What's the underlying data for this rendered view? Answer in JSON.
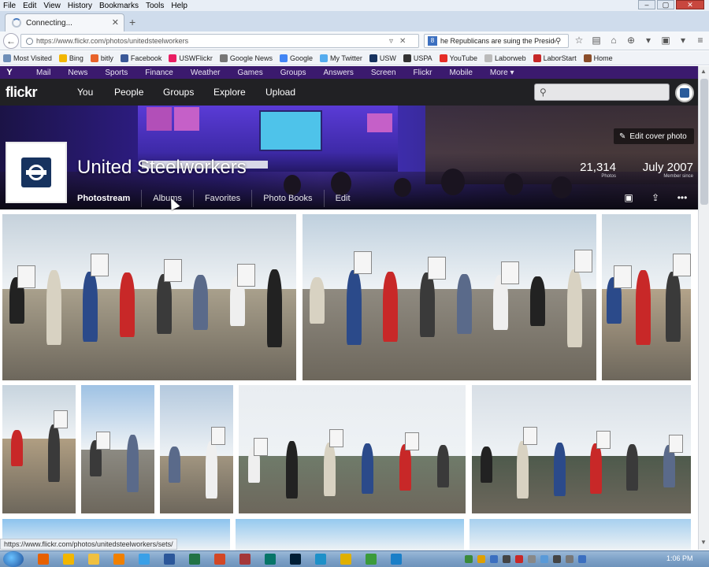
{
  "browser": {
    "menu": [
      "File",
      "Edit",
      "View",
      "History",
      "Bookmarks",
      "Tools",
      "Help"
    ],
    "tab_title": "Connecting...",
    "url": "https://www.flickr.com/photos/unitedsteelworkers",
    "search_value": "he Republicans are suing the President",
    "bookmarks": [
      {
        "label": "Most Visited",
        "color": "#6f8fb8"
      },
      {
        "label": "Bing",
        "color": "#f2b600"
      },
      {
        "label": "bitly",
        "color": "#e8632b"
      },
      {
        "label": "Facebook",
        "color": "#3b5998"
      },
      {
        "label": "USWFlickr",
        "color": "#e91e63"
      },
      {
        "label": "Google News",
        "color": "#777777"
      },
      {
        "label": "Google",
        "color": "#4285f4"
      },
      {
        "label": "My Twitter",
        "color": "#55acee"
      },
      {
        "label": "USW",
        "color": "#17335f"
      },
      {
        "label": "USPA",
        "color": "#333333"
      },
      {
        "label": "YouTube",
        "color": "#e52d27"
      },
      {
        "label": "Laborweb",
        "color": "#bbbbbb"
      },
      {
        "label": "LaborStart",
        "color": "#c62828"
      },
      {
        "label": "Home",
        "color": "#8a4d2a"
      }
    ],
    "status_url": "https://www.flickr.com/photos/unitedsteelworkers/sets/"
  },
  "yahoo": {
    "logo": "Y",
    "items": [
      "Mail",
      "News",
      "Sports",
      "Finance",
      "Weather",
      "Games",
      "Groups",
      "Answers",
      "Screen",
      "Flickr",
      "Mobile"
    ],
    "more": "More ▾"
  },
  "flickr": {
    "logo": "flickr",
    "nav": [
      "You",
      "People",
      "Groups",
      "Explore",
      "Upload"
    ],
    "search_placeholder": ""
  },
  "profile": {
    "name": "United Steelworkers",
    "photos_count": "21,314",
    "photos_label": "Photos",
    "member_since": "July 2007",
    "member_since_label": "Member since",
    "edit_cover": "Edit cover photo",
    "tabs": [
      "Photostream",
      "Albums",
      "Favorites",
      "Photo Books",
      "Edit"
    ],
    "active_tab": "Photostream"
  },
  "taskbar": {
    "clock": "1:06 PM",
    "apps": [
      {
        "name": "firefox",
        "color": "#e66000"
      },
      {
        "name": "outlook",
        "color": "#f2b600"
      },
      {
        "name": "explorer",
        "color": "#f0c040"
      },
      {
        "name": "media",
        "color": "#f08000"
      },
      {
        "name": "ie",
        "color": "#3aa0e8"
      },
      {
        "name": "word",
        "color": "#2b579a"
      },
      {
        "name": "excel",
        "color": "#217346"
      },
      {
        "name": "powerpoint",
        "color": "#d24726"
      },
      {
        "name": "access",
        "color": "#a4373a"
      },
      {
        "name": "publisher",
        "color": "#077568"
      },
      {
        "name": "photoshop",
        "color": "#001e36"
      },
      {
        "name": "edge",
        "color": "#1e90c8"
      },
      {
        "name": "chrome",
        "color": "#e0b000"
      },
      {
        "name": "camtasia",
        "color": "#3b9b3b"
      },
      {
        "name": "capture",
        "color": "#1a7fc8"
      }
    ]
  }
}
